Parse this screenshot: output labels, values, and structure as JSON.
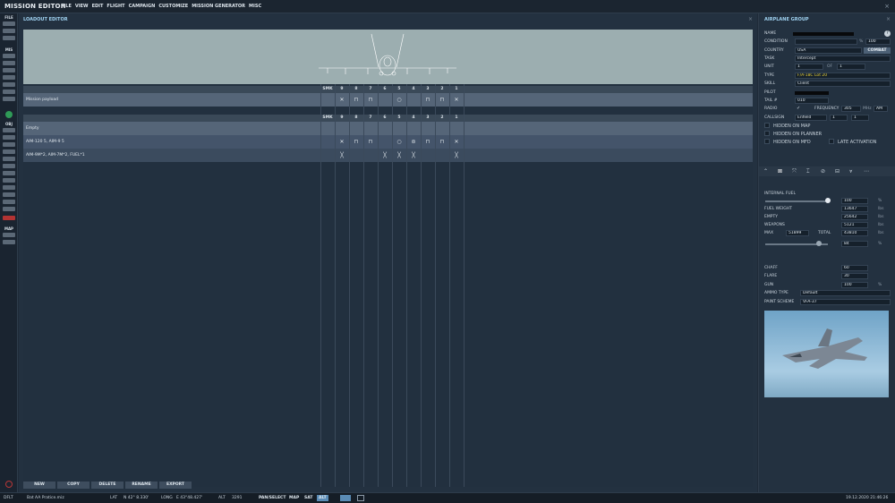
{
  "app": {
    "title": "MISSION EDITOR",
    "close_glyph": "×"
  },
  "menu": [
    "FILE",
    "VIEW",
    "EDIT",
    "FLIGHT",
    "CAMPAIGN",
    "CUSTOMIZE",
    "MISSION GENERATOR",
    "MISC"
  ],
  "toolbar": {
    "sections": [
      "FILE",
      "MIS",
      "OBJ",
      "MAP"
    ]
  },
  "loadout": {
    "title": "LOADOUT EDITOR",
    "close_glyph": "×",
    "columns": [
      "SMK",
      "9",
      "8",
      "7",
      "6",
      "5",
      "4",
      "3",
      "2",
      "1"
    ],
    "payload_row": {
      "label": "Mission payload",
      "pylons": [
        "",
        "✕",
        "⊓",
        "⊓",
        "",
        "○",
        "",
        "⊓",
        "⊓",
        "✕"
      ]
    },
    "rows": [
      {
        "label": "Empty",
        "pylons": [
          "",
          "",
          "",
          "",
          "",
          "",
          "",
          "",
          "",
          ""
        ]
      },
      {
        "label": "AIM-120 5, AIM-9 5",
        "pylons": [
          "",
          "✕",
          "⊓",
          "⊓",
          "",
          "○",
          "⊜",
          "⊓",
          "⊓",
          "✕"
        ]
      },
      {
        "label": "AIM-9M*2, AIM-7M*2, FUEL*1",
        "pylons": [
          "",
          "╳",
          "",
          "",
          "╳",
          "╳",
          "╳",
          "",
          "",
          "╳"
        ]
      }
    ],
    "buttons": [
      "NEW",
      "COPY",
      "DELETE",
      "RENAME",
      "EXPORT"
    ]
  },
  "group": {
    "title": "AIRPLANE GROUP",
    "close_glyph": "×",
    "labels": {
      "name": "NAME",
      "condition": "CONDITION",
      "country": "COUNTRY",
      "task": "TASK",
      "unit": "UNIT",
      "of": "OF",
      "type": "TYPE",
      "skill": "SKILL",
      "pilot": "PILOT",
      "tail": "TAIL #",
      "radio": "RADIO",
      "frequency": "FREQUENCY",
      "callsign": "CALLSIGN",
      "hidden_map": "HIDDEN ON MAP",
      "hidden_planner": "HIDDEN ON PLANNER",
      "hidden_mfd": "HIDDEN ON MFD",
      "late_activation": "LATE ACTIVATION"
    },
    "values": {
      "condition_pct": "%",
      "condition": "100",
      "country": "USA",
      "combat_btn": "COMBAT",
      "task": "Intercept",
      "unit": "1",
      "of": "1",
      "type": "F/A-18C Lot 20",
      "skill": "Client",
      "tail": "010",
      "radio_check": "✓",
      "frequency": "305",
      "freq_unit": "MHz",
      "band": "AM",
      "callsign": "Enfield",
      "callsign_n1": "1",
      "callsign_n2": "1"
    },
    "fuel": {
      "internal_fuel": "INTERNAL FUEL",
      "internal_val": "100",
      "pct": "%",
      "fuel_weight": "FUEL WEIGHT",
      "fuel_weight_val": "13647",
      "empty": "EMPTY",
      "empty_val": "25642",
      "weapons": "WEAPONS",
      "weapons_val": "5121",
      "max": "MAX",
      "max_val": "51899",
      "total": "TOTAL",
      "total_val": "43810",
      "pct2_val": "84",
      "unit_lbs": "lbs"
    },
    "ammo": {
      "chaff": "CHAFF",
      "chaff_val": "60",
      "flare": "FLARE",
      "flare_val": "30",
      "gun": "GUN",
      "gun_val": "100",
      "gun_unit": "%",
      "ammo_type": "AMMO TYPE",
      "ammo_type_val": "Default",
      "paint": "PAINT SCHEME",
      "paint_val": "VFA-37"
    }
  },
  "status": {
    "mode": "DFLT",
    "file": "Bat AA Pratice.miz",
    "lat_label": "LAT",
    "lat": "N 42° 8.330'",
    "long_label": "LONG",
    "long": "E 43°48.427'",
    "alt_label": "ALT",
    "alt": "3291",
    "pan": "PAN/SELECT",
    "map": "MAP",
    "sat": "SAT",
    "alt_btn": "ALT",
    "datetime": "19.12.2020 21:46:26"
  }
}
